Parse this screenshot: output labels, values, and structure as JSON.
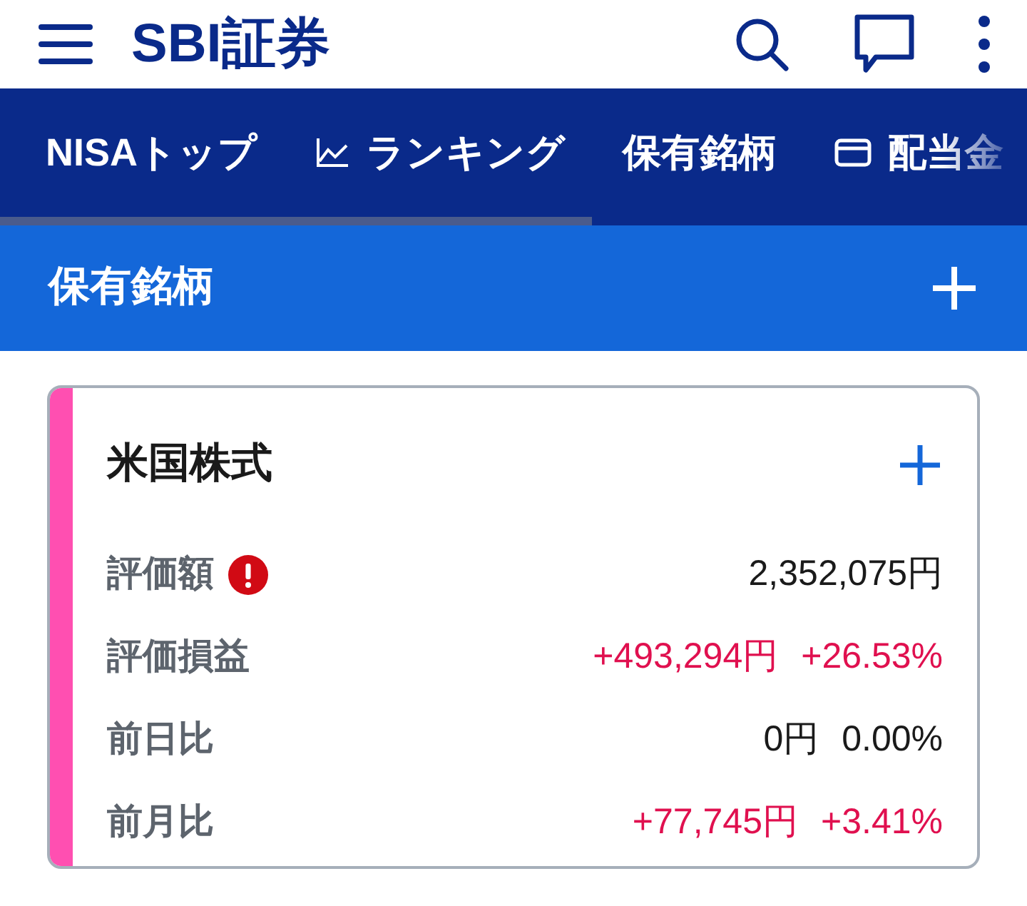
{
  "header": {
    "logo": "SBI証券"
  },
  "tabs": [
    {
      "label": "NISAトップ",
      "kind": "plain"
    },
    {
      "label": "ランキング",
      "kind": "chart"
    },
    {
      "label": "保有銘柄",
      "kind": "plain"
    },
    {
      "label": "配当金",
      "kind": "card"
    }
  ],
  "section": {
    "title": "保有銘柄"
  },
  "card": {
    "title": "米国株式",
    "rows": [
      {
        "label": "評価額",
        "warning": true,
        "values": [
          {
            "text": "2,352,075円",
            "color": "#1a1a1a"
          }
        ]
      },
      {
        "label": "評価損益",
        "warning": false,
        "values": [
          {
            "text": "+493,294円",
            "color": "#e0104f"
          },
          {
            "text": "+26.53%",
            "color": "#e0104f"
          }
        ]
      },
      {
        "label": "前日比",
        "warning": false,
        "values": [
          {
            "text": "0円",
            "color": "#1a1a1a"
          },
          {
            "text": "0.00%",
            "color": "#1a1a1a"
          }
        ]
      },
      {
        "label": "前月比",
        "warning": false,
        "values": [
          {
            "text": "+77,745円",
            "color": "#e0104f"
          },
          {
            "text": "+3.41%",
            "color": "#e0104f"
          }
        ]
      }
    ]
  }
}
